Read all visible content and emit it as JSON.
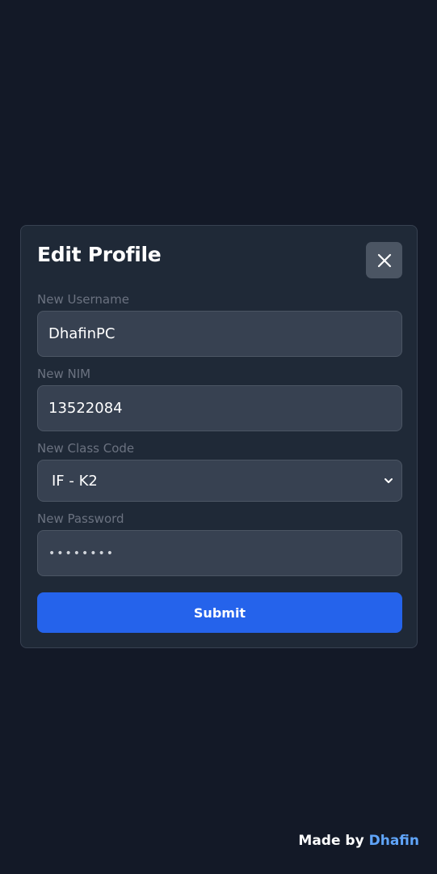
{
  "modal": {
    "title": "Edit Profile",
    "close_icon": "close-icon"
  },
  "form": {
    "username": {
      "label": "New Username",
      "value": "DhafinPC"
    },
    "nim": {
      "label": "New NIM",
      "value": "13522084"
    },
    "class_code": {
      "label": "New Class Code",
      "selected": "IF - K2",
      "icon": "chevron-down-icon"
    },
    "password": {
      "label": "New Password",
      "value": "••••••••"
    },
    "submit_label": "Submit"
  },
  "footer": {
    "prefix": "Made by",
    "author": "Dhafin"
  },
  "colors": {
    "background": "#131927",
    "card": "#1f2937",
    "input": "#374151",
    "accent": "#2563eb",
    "author_link": "#60a5fa"
  }
}
